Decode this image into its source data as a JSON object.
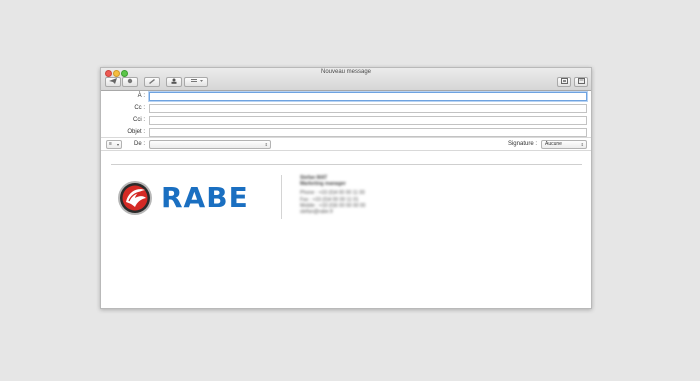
{
  "window": {
    "title": "Nouveau message"
  },
  "toolbar": {
    "left_icons": [
      "send-icon",
      "reply-icon",
      "attach-icon",
      "address-icon",
      "format-list-icon"
    ],
    "right_icons": [
      "photo-browser-icon",
      "template-icon"
    ]
  },
  "fields": {
    "to_label": "À :",
    "cc_label": "Cc :",
    "bcc_label": "Cci :",
    "subject_label": "Objet :",
    "from_label": "De :",
    "signature_label": "Signature :",
    "signature_value": "Aucune",
    "to_value": "",
    "cc_value": "",
    "bcc_value": "",
    "subject_value": "",
    "from_value": ""
  },
  "signature": {
    "brand": "RABE",
    "name": "Stefan MAT",
    "role": "Marketing manager",
    "line1": "Phone : +33 (0)4 00 00 11 00",
    "line2": "Fax : +33 (0)4 00 00 11 01",
    "line3": "Mobile : +33 (0)6 00 00 00 00",
    "line4": "stefan@rabe.fr"
  },
  "colors": {
    "brand_blue": "#1a6fc1",
    "brand_red": "#d42a25"
  }
}
